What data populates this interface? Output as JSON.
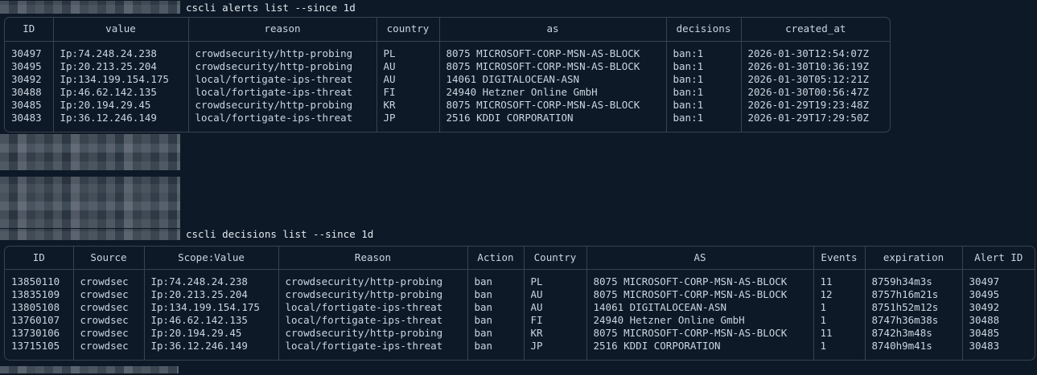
{
  "colors": {
    "background": "#0d1926",
    "text": "#cbd5e0",
    "command_text": "#e2e9f0",
    "table_border": "#3a424d"
  },
  "prompt_line_1": {
    "command": "cscli alerts list --since 1d"
  },
  "prompt_line_2": {
    "command": "cscli decisions list --since 1d"
  },
  "alerts_table": {
    "headers": [
      "ID",
      "value",
      "reason",
      "country",
      "as",
      "decisions",
      "created_at"
    ],
    "rows": [
      [
        "30497",
        "Ip:74.248.24.238",
        "crowdsecurity/http-probing",
        "PL",
        "8075 MICROSOFT-CORP-MSN-AS-BLOCK",
        "ban:1",
        "2026-01-30T12:54:07Z"
      ],
      [
        "30495",
        "Ip:20.213.25.204",
        "crowdsecurity/http-probing",
        "AU",
        "8075 MICROSOFT-CORP-MSN-AS-BLOCK",
        "ban:1",
        "2026-01-30T10:36:19Z"
      ],
      [
        "30492",
        "Ip:134.199.154.175",
        "local/fortigate-ips-threat",
        "AU",
        "14061 DIGITALOCEAN-ASN",
        "ban:1",
        "2026-01-30T05:12:21Z"
      ],
      [
        "30488",
        "Ip:46.62.142.135",
        "local/fortigate-ips-threat",
        "FI",
        "24940 Hetzner Online GmbH",
        "ban:1",
        "2026-01-30T00:56:47Z"
      ],
      [
        "30485",
        "Ip:20.194.29.45",
        "crowdsecurity/http-probing",
        "KR",
        "8075 MICROSOFT-CORP-MSN-AS-BLOCK",
        "ban:1",
        "2026-01-29T19:23:48Z"
      ],
      [
        "30483",
        "Ip:36.12.246.149",
        "local/fortigate-ips-threat",
        "JP",
        "2516 KDDI CORPORATION",
        "ban:1",
        "2026-01-29T17:29:50Z"
      ]
    ]
  },
  "decisions_table": {
    "headers": [
      "ID",
      "Source",
      "Scope:Value",
      "Reason",
      "Action",
      "Country",
      "AS",
      "Events",
      "expiration",
      "Alert ID"
    ],
    "rows": [
      [
        "13850110",
        "crowdsec",
        "Ip:74.248.24.238",
        "crowdsecurity/http-probing",
        "ban",
        "PL",
        "8075 MICROSOFT-CORP-MSN-AS-BLOCK",
        "11",
        "8759h34m3s",
        "30497"
      ],
      [
        "13835109",
        "crowdsec",
        "Ip:20.213.25.204",
        "crowdsecurity/http-probing",
        "ban",
        "AU",
        "8075 MICROSOFT-CORP-MSN-AS-BLOCK",
        "12",
        "8757h16m21s",
        "30495"
      ],
      [
        "13805108",
        "crowdsec",
        "Ip:134.199.154.175",
        "local/fortigate-ips-threat",
        "ban",
        "AU",
        "14061 DIGITALOCEAN-ASN",
        "1",
        "8751h52m12s",
        "30492"
      ],
      [
        "13760107",
        "crowdsec",
        "Ip:46.62.142.135",
        "local/fortigate-ips-threat",
        "ban",
        "FI",
        "24940 Hetzner Online GmbH",
        "1",
        "8747h36m38s",
        "30488"
      ],
      [
        "13730106",
        "crowdsec",
        "Ip:20.194.29.45",
        "crowdsecurity/http-probing",
        "ban",
        "KR",
        "8075 MICROSOFT-CORP-MSN-AS-BLOCK",
        "11",
        "8742h3m48s",
        "30485"
      ],
      [
        "13715105",
        "crowdsec",
        "Ip:36.12.246.149",
        "local/fortigate-ips-threat",
        "ban",
        "JP",
        "2516 KDDI CORPORATION",
        "1",
        "8740h9m41s",
        "30483"
      ]
    ]
  }
}
